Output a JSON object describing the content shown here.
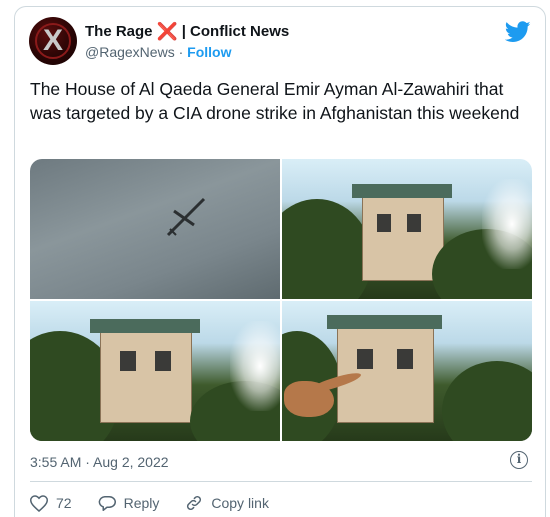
{
  "author": {
    "display_name": "The Rage",
    "name_suffix": "| Conflict News",
    "cross_glyph": "❌",
    "handle": "@RagexNews",
    "separator": "·",
    "follow_label": "Follow",
    "avatar_glyph": "X"
  },
  "tweet": {
    "text": "The House of Al Qaeda General Emir Ayman Al-Zawahiri that was targeted by a CIA drone strike in Afghanistan this weekend",
    "timestamp": "3:55 AM · Aug 2, 2022",
    "info_glyph": "i"
  },
  "actions": {
    "like_count": "72",
    "reply_label": "Reply",
    "copy_link_label": "Copy link"
  },
  "icons": {
    "brand": "twitter-bird-icon",
    "like": "heart-icon",
    "reply": "speech-bubble-icon",
    "copy": "link-icon",
    "info": "info-icon"
  },
  "colors": {
    "accent": "#1d9bf0",
    "text": "#0f1419",
    "secondary": "#536471",
    "cross": "#e0245e",
    "border": "#cfd9de"
  }
}
